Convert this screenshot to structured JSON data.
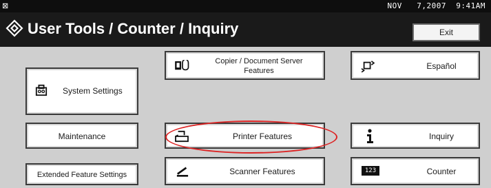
{
  "statusbar": {
    "datetime": "NOV   7,2007  9:41AM"
  },
  "title": "User Tools / Counter / Inquiry",
  "exit_label": "Exit",
  "buttons": {
    "system_settings": "System Settings",
    "copier": "Copier / Document Server\nFeatures",
    "language": "Español",
    "maintenance": "Maintenance",
    "printer": "Printer Features",
    "inquiry": "Inquiry",
    "extended": "Extended Feature Settings",
    "scanner": "Scanner Features",
    "counter": "Counter"
  },
  "icons": {
    "counter_icon_text": "123"
  },
  "colors": {
    "highlight_ring": "#dd2222"
  }
}
